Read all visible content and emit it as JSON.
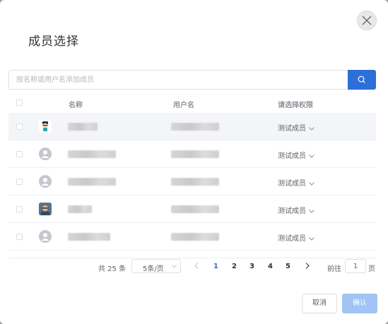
{
  "dialog": {
    "title": "成员选择",
    "search": {
      "placeholder": "按名称或用户名添加成员",
      "value": ""
    },
    "table": {
      "headers": {
        "name": "名称",
        "username": "用户名",
        "role": "请选择权限"
      },
      "rows": [
        {
          "avatar": "cartoon-avatar",
          "name": "████",
          "username": "████████",
          "role": "测试成员"
        },
        {
          "avatar": "default-avatar",
          "name": "████████",
          "username": "████████",
          "role": "测试成员"
        },
        {
          "avatar": "default-avatar",
          "name": "████████",
          "username": "████████",
          "role": "测试成员"
        },
        {
          "avatar": "photo-avatar",
          "name": "████",
          "username": "████████",
          "role": "测试成员"
        },
        {
          "avatar": "default-avatar",
          "name": "██████",
          "username": "████████",
          "role": "测试成员"
        }
      ]
    },
    "pagination": {
      "total": "共 25 条",
      "page_size": "5条/页",
      "pages": [
        "1",
        "2",
        "3",
        "4",
        "5"
      ],
      "current_page": "1",
      "goto_label": "前往",
      "goto_value": "1",
      "page_suffix": "页"
    },
    "buttons": {
      "cancel": "取消",
      "confirm": "确认"
    },
    "colors": {
      "primary": "#2d6fd9",
      "confirm_disabled": "#a0c4f3",
      "row_highlight": "#f3f5f9"
    }
  }
}
